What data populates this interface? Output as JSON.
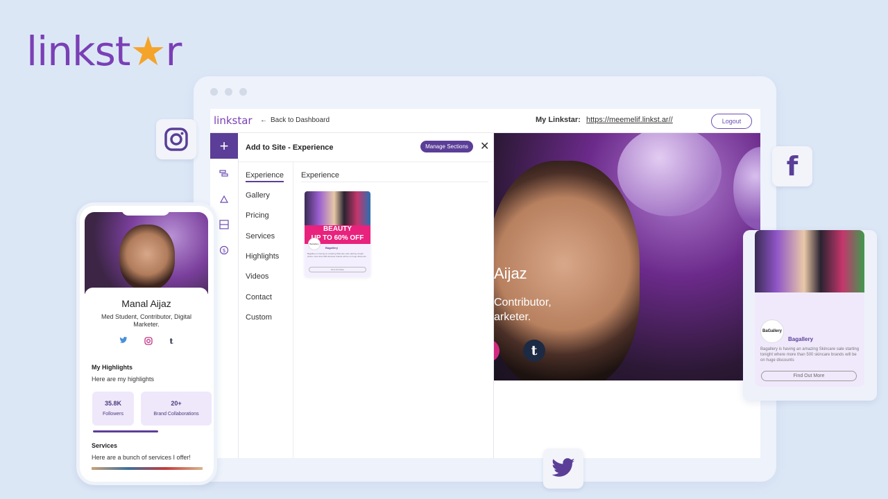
{
  "brand": {
    "name_pre": "linkst",
    "name_star": "★",
    "name_post": "r"
  },
  "topbar": {
    "logo": "linkstar",
    "back_icon": "←",
    "back_label": "Back to Dashboard",
    "my_linkstar_label": "My Linkstar:",
    "url": "https://meemelif.linkst.ar//",
    "logout_label": "Logout"
  },
  "panel": {
    "add_icon": "+",
    "title": "Add to Site - Experience",
    "manage_label": "Manage Sections",
    "close_icon": "✕",
    "menu": [
      "Experience",
      "Gallery",
      "Pricing",
      "Services",
      "Highlights",
      "Videos",
      "Contact",
      "Custom"
    ],
    "content_title": "Experience",
    "card": {
      "banner_line1": "BEAUTY",
      "banner_line2": "UP TO 60% OFF",
      "logo_text": "BaGallery",
      "name": "Bagallery",
      "desc": "Bagallery is having an amazing Skincare sale starting tonight where more than 500 skincare brands will be on huge discounts",
      "button": "Find Out More"
    }
  },
  "preview": {
    "name": "Aijaz",
    "tagline1": "Contributor,",
    "tagline2": "arketer.",
    "tumblr_icon": "t"
  },
  "product_card": {
    "logo_text": "BaGallery",
    "name": "Bagallery",
    "desc": "Bagallery is having an amazing Skincare sale starting tonight where more than 500 skincare brands will be on huge discounts",
    "button": "Find Out More"
  },
  "phone": {
    "name": "Manal Aijaz",
    "bio": "Med Student, Contributor, Digital Marketer.",
    "highlights_title": "My Highlights",
    "highlights_sub": "Here are my highlights",
    "stats": [
      {
        "value": "35.8K",
        "label": "Followers"
      },
      {
        "value": "20+",
        "label": "Brand Collaborations"
      }
    ],
    "services_title": "Services",
    "services_sub": "Here are a bunch of services I offer!",
    "social_icons": {
      "twitter": "🐦",
      "instagram": "◎",
      "tumblr": "t"
    }
  },
  "social_tiles": {
    "facebook": "f"
  },
  "colors": {
    "brand": "#7a3fb5",
    "accent": "#5b3e97",
    "background": "#dce7f6"
  }
}
